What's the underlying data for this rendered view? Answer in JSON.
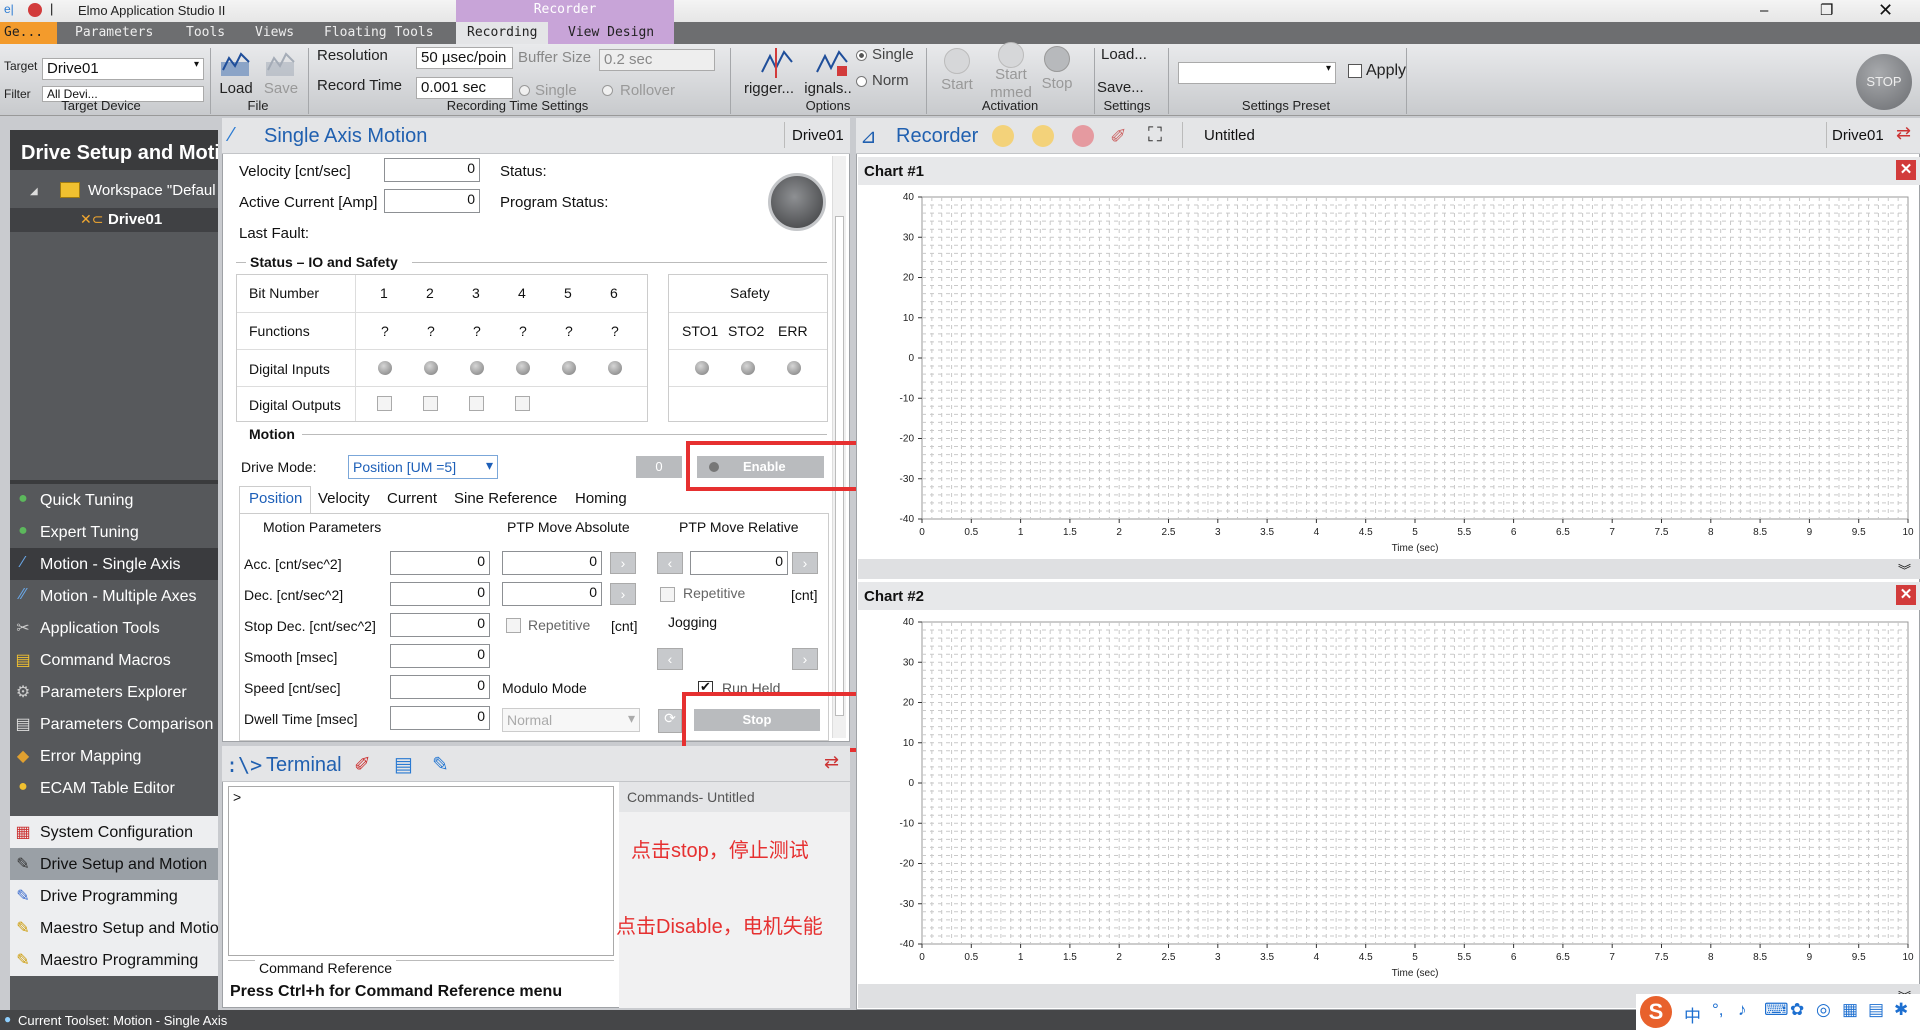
{
  "window": {
    "title": "Elmo Application Studio II"
  },
  "menu": [
    "Ge...",
    "Parameters",
    "Tools",
    "Views",
    "Floating Tools",
    "Recording",
    "View Design"
  ],
  "recorder_context_tab": "Recorder",
  "ribbon": {
    "target_label": "Target",
    "target_value": "Drive01",
    "filter_label": "Filter",
    "filter_value": "All Devi...",
    "group_target": "Target Device",
    "load": "Load",
    "save": "Save",
    "group_file": "File",
    "resolution_label": "Resolution",
    "resolution_value": "50 µsec/poin",
    "buffer_label": "Buffer Size",
    "buffer_value": "0.2 sec",
    "record_time_label": "Record Time",
    "record_time_value": "0.001 sec",
    "single": "Single",
    "rollover": "Rollover",
    "group_recording": "Recording Time Settings",
    "trigger": "rigger...",
    "signals": "ignals..",
    "opt_single": "Single",
    "opt_norm": "Norm",
    "group_options": "Options",
    "start": "Start",
    "start_immed": "Start",
    "start_immed2": "mmed",
    "stop": "Stop",
    "group_activation": "Activation",
    "settings_load": "Load...",
    "settings_save": "Save...",
    "group_settings": "Settings",
    "apply": "Apply",
    "group_preset": "Settings Preset",
    "stop_circle": "STOP"
  },
  "left": {
    "header": "Drive Setup and Moti",
    "workspace": "Workspace \"Defaul",
    "drive": "Drive01",
    "tools": [
      "Quick Tuning",
      "Expert Tuning",
      "Motion - Single Axis",
      "Motion - Multiple Axes",
      "Application Tools",
      "Command Macros",
      "Parameters Explorer",
      "Parameters Comparison",
      "Error Mapping",
      "ECAM Table Editor"
    ],
    "bottom": [
      "System Configuration",
      "Drive Setup and Motion",
      "Drive Programming",
      "Maestro Setup and Motio",
      "Maestro Programming"
    ]
  },
  "sam": {
    "title": "Single Axis Motion",
    "drive": "Drive01",
    "velocity_label": "Velocity  [cnt/sec]",
    "velocity": "0",
    "current_label": "Active Current [Amp]",
    "current": "0",
    "status_label": "Status:",
    "program_status_label": "Program Status:",
    "last_fault_label": "Last Fault:",
    "io_section": "Status – IO and Safety",
    "bit_number": "Bit Number",
    "bits": [
      "1",
      "2",
      "3",
      "4",
      "5",
      "6"
    ],
    "functions": "Functions",
    "func_values": [
      "?",
      "?",
      "?",
      "?",
      "?",
      "?"
    ],
    "digital_inputs": "Digital Inputs",
    "digital_outputs": "Digital Outputs",
    "safety": "Safety",
    "safety_items": [
      "STO1",
      "STO2",
      "ERR"
    ],
    "motion_section": "Motion",
    "drive_mode_label": "Drive Mode:",
    "drive_mode": "Position [UM =5]",
    "zero_badge": "0",
    "enable": "Enable",
    "tabs": [
      "Position",
      "Velocity",
      "Current",
      "Sine Reference",
      "Homing"
    ],
    "motion_params": "Motion Parameters",
    "ptp_abs": "PTP Move Absolute",
    "ptp_rel": "PTP Move Relative",
    "params": [
      {
        "label": "Acc. [cnt/sec^2]",
        "value": "0"
      },
      {
        "label": "Dec. [cnt/sec^2]",
        "value": "0"
      },
      {
        "label": "Stop Dec. [cnt/sec^2]",
        "value": "0"
      },
      {
        "label": "Smooth [msec]",
        "value": "0"
      },
      {
        "label": "Speed [cnt/sec]",
        "value": "0"
      },
      {
        "label": "Dwell Time [msec]",
        "value": "0"
      }
    ],
    "abs_values": [
      "0",
      "0"
    ],
    "rel_value": "0",
    "repetitive": "Repetitive",
    "cnt": "[cnt]",
    "jogging": "Jogging",
    "modulo_mode": "Modulo Mode",
    "modulo_value": "Normal",
    "run_held": "Run Held",
    "stop_btn": "Stop"
  },
  "annotations": {
    "circle1": "①",
    "circle2": "②"
  },
  "terminal": {
    "title": "Terminal",
    "prompt": ">",
    "commands_title": "Commands- Untitled",
    "note1": "点击stop，停止测试",
    "note2": "点击Disable，电机失能",
    "cmdref_label": "Command Reference",
    "cmdref_hint": "Press Ctrl+h for Command Reference menu"
  },
  "recorder": {
    "title": "Recorder",
    "doc": "Untitled",
    "drive": "Drive01"
  },
  "chart_data": [
    {
      "type": "line",
      "title": "Chart #1",
      "xlabel": "Time (sec)",
      "ylabel": "",
      "xlim": [
        0,
        10
      ],
      "ylim": [
        -40,
        40
      ],
      "x_ticks": [
        "0",
        "0.5",
        "1",
        "1.5",
        "2",
        "2.5",
        "3",
        "3.5",
        "4",
        "4.5",
        "5",
        "5.5",
        "6",
        "6.5",
        "7",
        "7.5",
        "8",
        "8.5",
        "9",
        "9.5",
        "10"
      ],
      "y_ticks": [
        "40",
        "30",
        "20",
        "10",
        "0",
        "-10",
        "-20",
        "-30",
        "-40"
      ],
      "grid": true,
      "series": []
    },
    {
      "type": "line",
      "title": "Chart #2",
      "xlabel": "Time (sec)",
      "ylabel": "",
      "xlim": [
        0,
        10
      ],
      "ylim": [
        -40,
        40
      ],
      "x_ticks": [
        "0",
        "0.5",
        "1",
        "1.5",
        "2",
        "2.5",
        "3",
        "3.5",
        "4",
        "4.5",
        "5",
        "5.5",
        "6",
        "6.5",
        "7",
        "7.5",
        "8",
        "8.5",
        "9",
        "9.5",
        "10"
      ],
      "y_ticks": [
        "40",
        "30",
        "20",
        "10",
        "0",
        "-10",
        "-20",
        "-30",
        "-40"
      ],
      "grid": true,
      "series": []
    }
  ],
  "status_bar": "Current Toolset: Motion - Single Axis",
  "taskbar": {
    "ime": "中"
  }
}
